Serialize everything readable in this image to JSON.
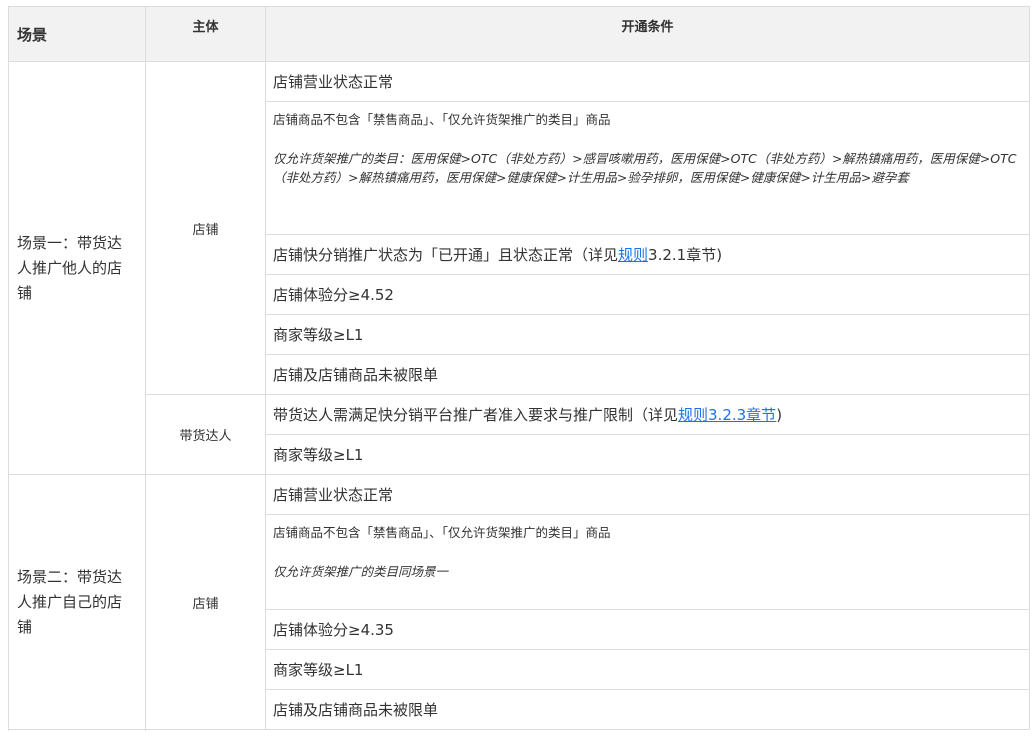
{
  "headers": {
    "scene": "场景",
    "subject": "主体",
    "conditions": "开通条件"
  },
  "scenario1": {
    "label": "场景一：带货达人推广他人的店铺",
    "shop_subject": "店铺",
    "shop_rows": {
      "status": "店铺营业状态正常",
      "goods": "店铺商品不包含「禁售商品」、「仅允许货架推广的类目」商品",
      "categories_note": "仅允许货架推广的类目：医用保健>OTC（非处方药）>感冒咳嗽用药，医用保健>OTC（非处方药）>解热镇痛用药，医用保健>OTC（非处方药）>解热镇痛用药，医用保健>健康保健>计生用品>验孕排卵，医用保健>健康保健>计生用品>避孕套",
      "promo_prefix": "店铺快分销推广状态为「已开通」且状态正常（详见",
      "promo_link": "规则",
      "promo_suffix": "3.2.1章节)",
      "score": "店铺体验分≥4.52",
      "level": "商家等级≥L1",
      "limit": "店铺及店铺商品未被限单"
    },
    "creator_subject": "带货达人",
    "creator_rows": {
      "req_prefix": "带货达人需满足快分销平台推广者准入要求与推广限制（详见",
      "req_link": "规则3.2.3章节",
      "req_suffix": ")",
      "level": "商家等级≥L1"
    }
  },
  "scenario2": {
    "label": "场景二：带货达人推广自己的店铺",
    "shop_subject": "店铺",
    "rows": {
      "status": "店铺营业状态正常",
      "goods": "店铺商品不包含「禁售商品」、「仅允许货架推广的类目」商品",
      "categories_note": "仅允许货架推广的类目同场景一",
      "score": "店铺体验分≥4.35",
      "level": "商家等级≥L1",
      "limit": "店铺及店铺商品未被限单"
    }
  },
  "colors": {
    "header_bg": "#f2f2f2",
    "border": "#dcdcdc",
    "link": "#1a73e8"
  }
}
